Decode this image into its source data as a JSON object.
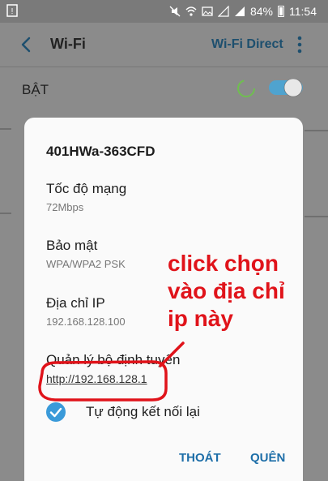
{
  "status_bar": {
    "battery": "84%",
    "time": "11:54",
    "icons": [
      "notification-icon",
      "mute-icon",
      "wifi-icon",
      "image-icon",
      "signal-icon",
      "sim-signal-icon",
      "battery-icon"
    ]
  },
  "app_bar": {
    "title": "Wi-Fi",
    "wifi_direct": "Wi-Fi Direct",
    "icons": [
      "back-arrow-icon",
      "more-vert-icon"
    ]
  },
  "wifi_toggle": {
    "label": "BẬT",
    "state": "on"
  },
  "dialog": {
    "network_name": "401HWa-363CFD",
    "fields": [
      {
        "label": "Tốc độ mạng",
        "value": "72Mbps"
      },
      {
        "label": "Bảo mật",
        "value": "WPA/WPA2 PSK"
      },
      {
        "label": "Địa chỉ IP",
        "value": "192.168.128.100"
      }
    ],
    "router_label": "Quản lý bộ định tuyến",
    "router_link": "http://192.168.128.1",
    "auto_reconnect_label": "Tự động kết nối lại",
    "auto_reconnect_checked": true,
    "buttons": {
      "exit": "THOÁT",
      "forget": "QUÊN"
    }
  },
  "annotation": {
    "lines": [
      "click chọn",
      "vào địa chỉ",
      "ip này"
    ],
    "color": "#e0131a"
  },
  "colors": {
    "accent": "#1d6ea8",
    "check": "#3a9ad9",
    "toggle_on": "#4fa3cf",
    "annotation": "#e0131a"
  }
}
